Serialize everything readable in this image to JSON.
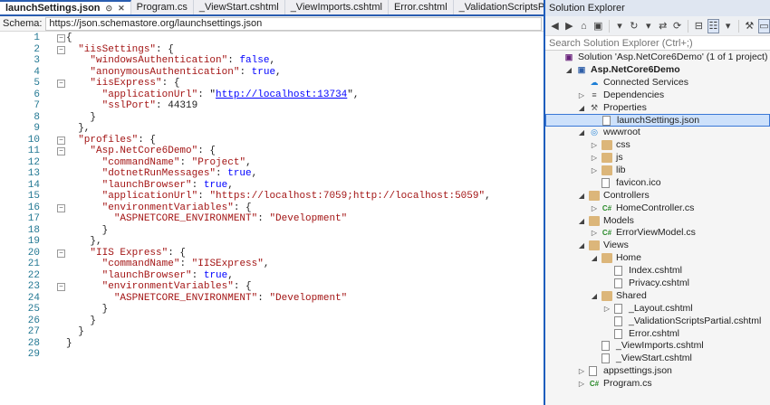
{
  "tabs": [
    {
      "label": "launchSettings.json",
      "active": true
    },
    {
      "label": "Program.cs"
    },
    {
      "label": "_ViewStart.cshtml"
    },
    {
      "label": "_ViewImports.cshtml"
    },
    {
      "label": "Error.cshtml"
    },
    {
      "label": "_ValidationScriptsPartial."
    }
  ],
  "schema": {
    "label": "Schema:",
    "value": "https://json.schemastore.org/launchsettings.json"
  },
  "code_lines": [
    [
      [
        "pun",
        "{"
      ]
    ],
    [
      [
        "pun",
        "  "
      ],
      [
        "key",
        "\"iisSettings\""
      ],
      [
        "pun",
        ": {"
      ]
    ],
    [
      [
        "pun",
        "    "
      ],
      [
        "key",
        "\"windowsAuthentication\""
      ],
      [
        "pun",
        ": "
      ],
      [
        "kw",
        "false"
      ],
      [
        "pun",
        ","
      ]
    ],
    [
      [
        "pun",
        "    "
      ],
      [
        "key",
        "\"anonymousAuthentication\""
      ],
      [
        "pun",
        ": "
      ],
      [
        "kw",
        "true"
      ],
      [
        "pun",
        ","
      ]
    ],
    [
      [
        "pun",
        "    "
      ],
      [
        "key",
        "\"iisExpress\""
      ],
      [
        "pun",
        ": {"
      ]
    ],
    [
      [
        "pun",
        "      "
      ],
      [
        "key",
        "\"applicationUrl\""
      ],
      [
        "pun",
        ": \""
      ],
      [
        "url",
        "http://localhost:13734"
      ],
      [
        "pun",
        "\","
      ]
    ],
    [
      [
        "pun",
        "      "
      ],
      [
        "key",
        "\"sslPort\""
      ],
      [
        "pun",
        ": "
      ],
      [
        "pun",
        "44319"
      ]
    ],
    [
      [
        "pun",
        "    }"
      ]
    ],
    [
      [
        "pun",
        "  },"
      ]
    ],
    [
      [
        "pun",
        "  "
      ],
      [
        "key",
        "\"profiles\""
      ],
      [
        "pun",
        ": {"
      ]
    ],
    [
      [
        "pun",
        "    "
      ],
      [
        "key",
        "\"Asp.NetCore6Demo\""
      ],
      [
        "pun",
        ": {"
      ]
    ],
    [
      [
        "pun",
        "      "
      ],
      [
        "key",
        "\"commandName\""
      ],
      [
        "pun",
        ": "
      ],
      [
        "str",
        "\"Project\""
      ],
      [
        "pun",
        ","
      ]
    ],
    [
      [
        "pun",
        "      "
      ],
      [
        "key",
        "\"dotnetRunMessages\""
      ],
      [
        "pun",
        ": "
      ],
      [
        "kw",
        "true"
      ],
      [
        "pun",
        ","
      ]
    ],
    [
      [
        "pun",
        "      "
      ],
      [
        "key",
        "\"launchBrowser\""
      ],
      [
        "pun",
        ": "
      ],
      [
        "kw",
        "true"
      ],
      [
        "pun",
        ","
      ]
    ],
    [
      [
        "pun",
        "      "
      ],
      [
        "key",
        "\"applicationUrl\""
      ],
      [
        "pun",
        ": "
      ],
      [
        "str",
        "\"https://localhost:7059;http://localhost:5059\""
      ],
      [
        "pun",
        ","
      ]
    ],
    [
      [
        "pun",
        "      "
      ],
      [
        "key",
        "\"environmentVariables\""
      ],
      [
        "pun",
        ": {"
      ]
    ],
    [
      [
        "pun",
        "        "
      ],
      [
        "key",
        "\"ASPNETCORE_ENVIRONMENT\""
      ],
      [
        "pun",
        ": "
      ],
      [
        "str",
        "\"Development\""
      ]
    ],
    [
      [
        "pun",
        "      }"
      ]
    ],
    [
      [
        "pun",
        "    },"
      ]
    ],
    [
      [
        "pun",
        "    "
      ],
      [
        "key",
        "\"IIS Express\""
      ],
      [
        "pun",
        ": {"
      ]
    ],
    [
      [
        "pun",
        "      "
      ],
      [
        "key",
        "\"commandName\""
      ],
      [
        "pun",
        ": "
      ],
      [
        "str",
        "\"IISExpress\""
      ],
      [
        "pun",
        ","
      ]
    ],
    [
      [
        "pun",
        "      "
      ],
      [
        "key",
        "\"launchBrowser\""
      ],
      [
        "pun",
        ": "
      ],
      [
        "kw",
        "true"
      ],
      [
        "pun",
        ","
      ]
    ],
    [
      [
        "pun",
        "      "
      ],
      [
        "key",
        "\"environmentVariables\""
      ],
      [
        "pun",
        ": {"
      ]
    ],
    [
      [
        "pun",
        "        "
      ],
      [
        "key",
        "\"ASPNETCORE_ENVIRONMENT\""
      ],
      [
        "pun",
        ": "
      ],
      [
        "str",
        "\"Development\""
      ]
    ],
    [
      [
        "pun",
        "      }"
      ]
    ],
    [
      [
        "pun",
        "    }"
      ]
    ],
    [
      [
        "pun",
        "  }"
      ]
    ],
    [
      [
        "pun",
        "}"
      ]
    ],
    [
      [
        "pun",
        ""
      ]
    ]
  ],
  "fold_lines": [
    1,
    2,
    5,
    10,
    11,
    16,
    20,
    23
  ],
  "explorer": {
    "title": "Solution Explorer",
    "search_placeholder": "Search Solution Explorer (Ctrl+;)",
    "toolbar_icons": [
      "back-icon",
      "forward-icon",
      "home-icon",
      "solution-icon",
      "dropdown-icon",
      "history-icon",
      "dropdown-icon",
      "sync-icon",
      "refresh-icon",
      "collapse-icon",
      "show-all-files-icon",
      "dropdown-icon",
      "properties-icon",
      "preview-icon"
    ],
    "tree": [
      {
        "label": "Solution 'Asp.NetCore6Demo' (1 of 1 project)",
        "depth": 0,
        "icon": "sln",
        "arrow": ""
      },
      {
        "label": "Asp.NetCore6Demo",
        "depth": 1,
        "icon": "proj",
        "arrow": "open",
        "bold": true
      },
      {
        "label": "Connected Services",
        "depth": 2,
        "icon": "cloud",
        "arrow": ""
      },
      {
        "label": "Dependencies",
        "depth": 2,
        "icon": "dep",
        "arrow": "closed"
      },
      {
        "label": "Properties",
        "depth": 2,
        "icon": "wrench",
        "arrow": "open"
      },
      {
        "label": "launchSettings.json",
        "depth": 3,
        "icon": "file",
        "arrow": "",
        "selected": true
      },
      {
        "label": "wwwroot",
        "depth": 2,
        "icon": "globe",
        "arrow": "open"
      },
      {
        "label": "css",
        "depth": 3,
        "icon": "folder",
        "arrow": "closed"
      },
      {
        "label": "js",
        "depth": 3,
        "icon": "folder",
        "arrow": "closed"
      },
      {
        "label": "lib",
        "depth": 3,
        "icon": "folder",
        "arrow": "closed"
      },
      {
        "label": "favicon.ico",
        "depth": 3,
        "icon": "file",
        "arrow": ""
      },
      {
        "label": "Controllers",
        "depth": 2,
        "icon": "folder",
        "arrow": "open"
      },
      {
        "label": "HomeController.cs",
        "depth": 3,
        "icon": "cs",
        "arrow": "closed"
      },
      {
        "label": "Models",
        "depth": 2,
        "icon": "folder",
        "arrow": "open"
      },
      {
        "label": "ErrorViewModel.cs",
        "depth": 3,
        "icon": "cs",
        "arrow": "closed"
      },
      {
        "label": "Views",
        "depth": 2,
        "icon": "folder",
        "arrow": "open"
      },
      {
        "label": "Home",
        "depth": 3,
        "icon": "folder",
        "arrow": "open"
      },
      {
        "label": "Index.cshtml",
        "depth": 4,
        "icon": "file",
        "arrow": ""
      },
      {
        "label": "Privacy.cshtml",
        "depth": 4,
        "icon": "file",
        "arrow": ""
      },
      {
        "label": "Shared",
        "depth": 3,
        "icon": "folder",
        "arrow": "open"
      },
      {
        "label": "_Layout.cshtml",
        "depth": 4,
        "icon": "file",
        "arrow": "closed"
      },
      {
        "label": "_ValidationScriptsPartial.cshtml",
        "depth": 4,
        "icon": "file",
        "arrow": ""
      },
      {
        "label": "Error.cshtml",
        "depth": 4,
        "icon": "file",
        "arrow": ""
      },
      {
        "label": "_ViewImports.cshtml",
        "depth": 3,
        "icon": "file",
        "arrow": ""
      },
      {
        "label": "_ViewStart.cshtml",
        "depth": 3,
        "icon": "file",
        "arrow": ""
      },
      {
        "label": "appsettings.json",
        "depth": 2,
        "icon": "file",
        "arrow": "closed"
      },
      {
        "label": "Program.cs",
        "depth": 2,
        "icon": "cs",
        "arrow": "closed"
      }
    ]
  },
  "colors": {
    "accent": "#1e5dbd",
    "selection": "#cde1fb",
    "line_number": "#237893"
  }
}
